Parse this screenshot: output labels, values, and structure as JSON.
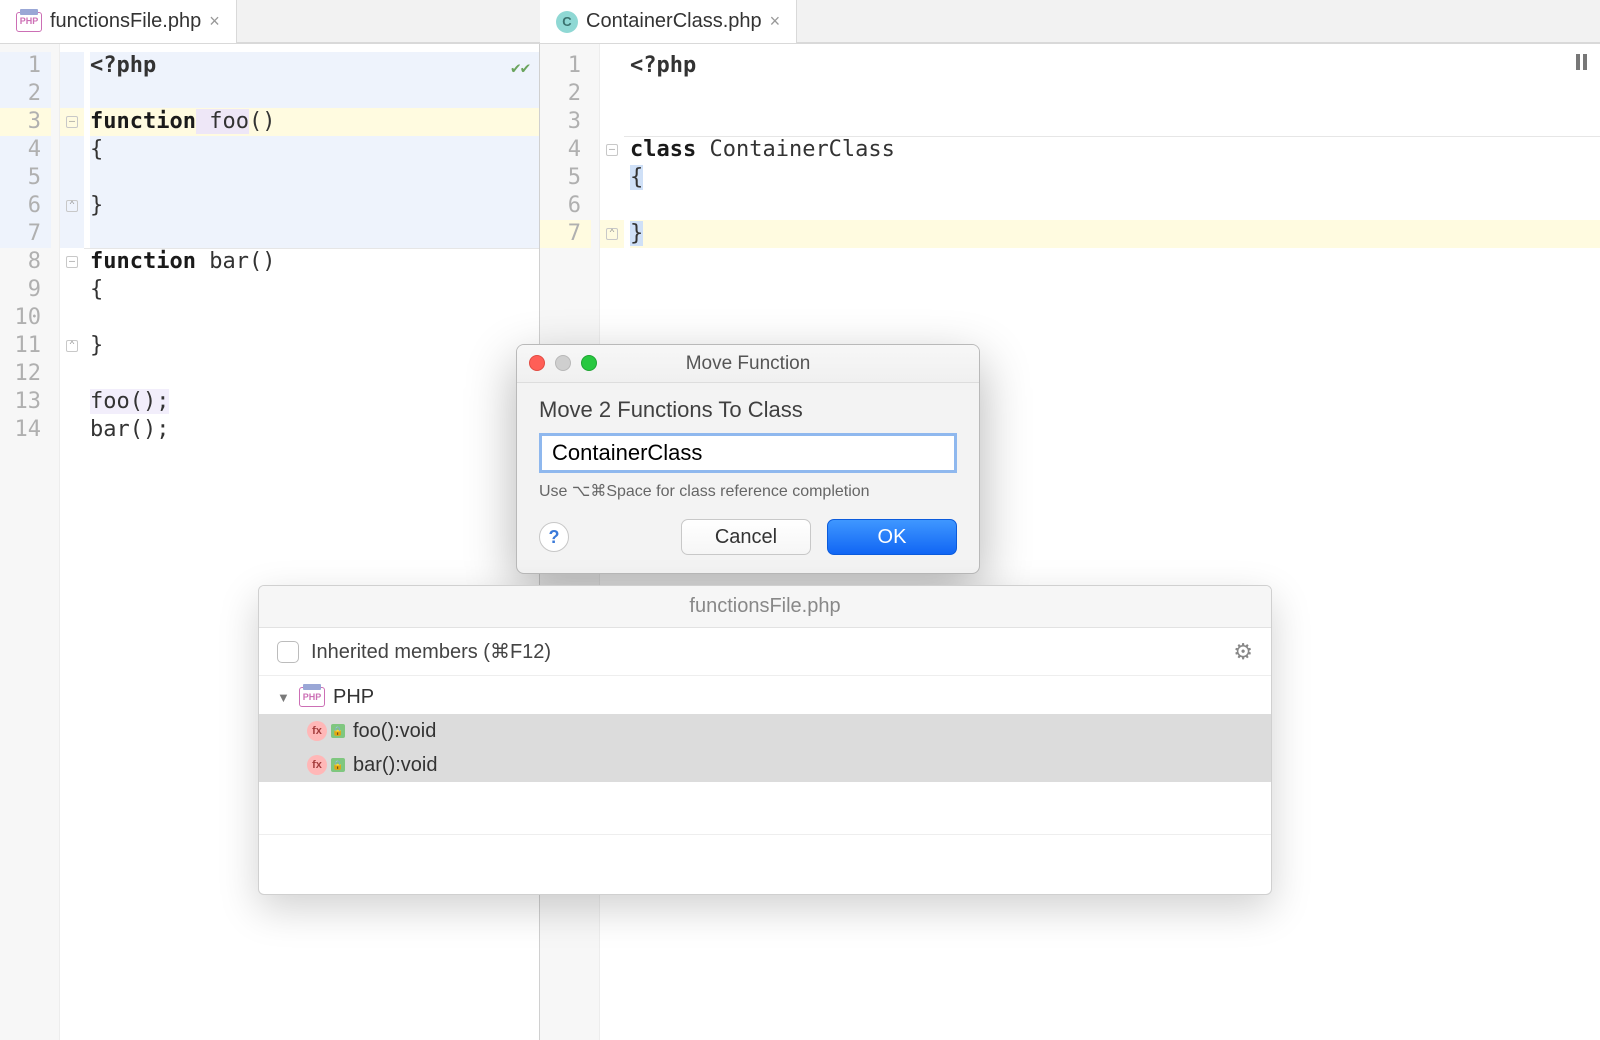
{
  "tabs": {
    "left": {
      "label": "functionsFile.php"
    },
    "right": {
      "label": "ContainerClass.php",
      "iconLetter": "C"
    }
  },
  "leftEditor": {
    "lines": [
      "1",
      "2",
      "3",
      "4",
      "5",
      "6",
      "7",
      "8",
      "9",
      "10",
      "11",
      "12",
      "13",
      "14"
    ],
    "code": {
      "l1": "<?php",
      "l2": "",
      "l3_kw": "function",
      "l3_name": " foo",
      "l3_paren": "()",
      "l4": "{",
      "l5": "",
      "l6": "}",
      "l7": "",
      "l8_kw": "function",
      "l8_name": " bar()",
      "l9": "{",
      "l10": "",
      "l11": "}",
      "l12": "",
      "l13": "foo();",
      "l14": "bar();"
    }
  },
  "rightEditor": {
    "lines": [
      "1",
      "2",
      "3",
      "4",
      "5",
      "6",
      "7"
    ],
    "code": {
      "l1": "<?php",
      "l2": "",
      "l3": "",
      "l4_kw": "class",
      "l4_name": " ContainerClass",
      "l5": "{",
      "l6": "",
      "l7": "}"
    }
  },
  "dialog": {
    "title": "Move Function",
    "heading": "Move 2 Functions To Class",
    "input": "ContainerClass",
    "hint": "Use ⌥⌘Space for class reference completion",
    "help": "?",
    "cancel": "Cancel",
    "ok": "OK"
  },
  "structure": {
    "title": "functionsFile.php",
    "inherited": "Inherited members (⌘F12)",
    "root": "PHP",
    "items": [
      "foo():void",
      "bar():void"
    ]
  }
}
